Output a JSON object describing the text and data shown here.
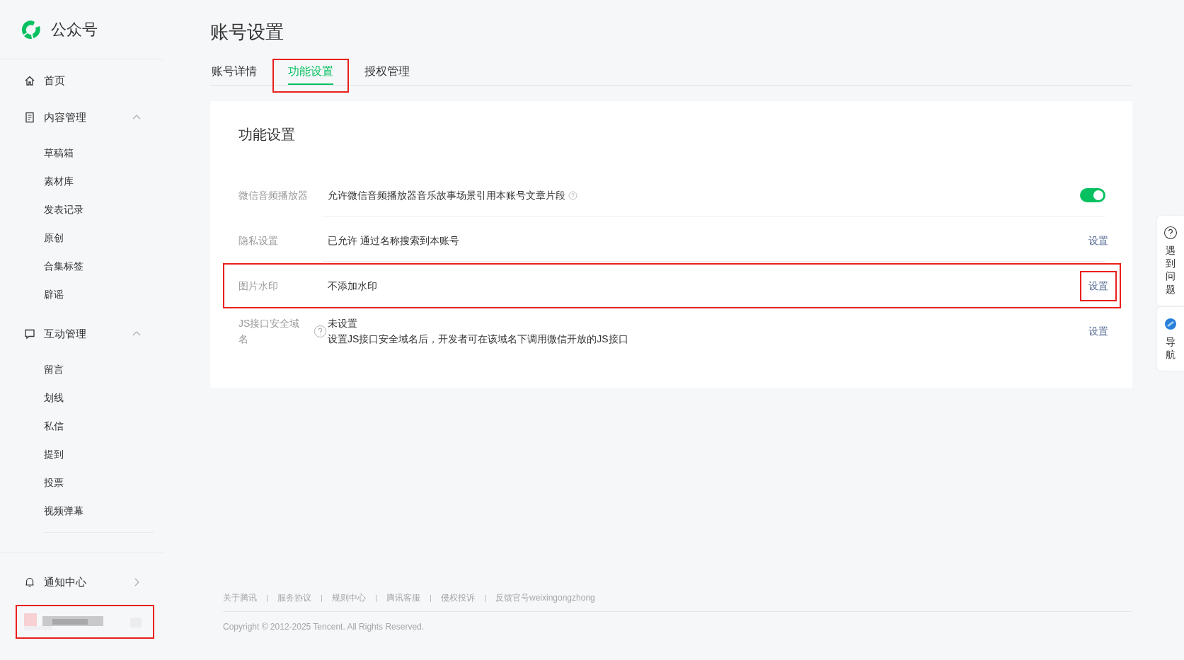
{
  "sidebar": {
    "logo": "公众号",
    "items": [
      {
        "label": "首页"
      },
      {
        "label": "内容管理",
        "expanded": true,
        "children": [
          {
            "label": "草稿箱"
          },
          {
            "label": "素材库"
          },
          {
            "label": "发表记录"
          },
          {
            "label": "原创"
          },
          {
            "label": "合集标签"
          },
          {
            "label": "辟谣"
          }
        ]
      },
      {
        "label": "互动管理",
        "expanded": true,
        "children": [
          {
            "label": "留言"
          },
          {
            "label": "划线"
          },
          {
            "label": "私信"
          },
          {
            "label": "提到"
          },
          {
            "label": "投票"
          },
          {
            "label": "视频弹幕"
          }
        ]
      }
    ],
    "notification": {
      "label": "通知中心"
    },
    "account": {
      "highlighted": true
    }
  },
  "page": {
    "title": "账号设置",
    "tabs": [
      {
        "label": "账号详情",
        "selected": false,
        "highlighted": false
      },
      {
        "label": "功能设置",
        "selected": true,
        "highlighted": true
      },
      {
        "label": "授权管理",
        "selected": false,
        "highlighted": false
      }
    ]
  },
  "card": {
    "title": "功能设置",
    "rows": [
      {
        "kind": "toggle",
        "label": "微信音频播放器",
        "value": "允许微信音频播放器音乐故事场景引用本账号文章片段",
        "value_help": true,
        "on": true,
        "highlighted": false
      },
      {
        "kind": "link",
        "label": "隐私设置",
        "value": "已允许 通过名称搜索到本账号",
        "action": "设置",
        "highlighted": false,
        "action_highlighted": false
      },
      {
        "kind": "link",
        "label": "图片水印",
        "value": "不添加水印",
        "action": "设置",
        "highlighted": true,
        "action_highlighted": true
      },
      {
        "kind": "link",
        "label": "JS接口安全域名",
        "label_help": true,
        "value": "未设置",
        "value_help": false,
        "description": "设置JS接口安全域名后，开发者可在该域名下调用微信开放的JS接口",
        "action": "设置",
        "highlighted": false,
        "action_highlighted": false
      }
    ]
  },
  "footer": {
    "links": [
      "关于腾讯",
      "服务协议",
      "规则中心",
      "腾讯客服",
      "侵权投诉",
      "反馈官号weixingongzhong"
    ],
    "copyright": "Copyright © 2012-2025 Tencent. All Rights Reserved."
  },
  "float_panel": {
    "items": [
      {
        "kind": "help",
        "label": "遇到问题"
      },
      {
        "kind": "nav",
        "label": "导航"
      }
    ]
  }
}
